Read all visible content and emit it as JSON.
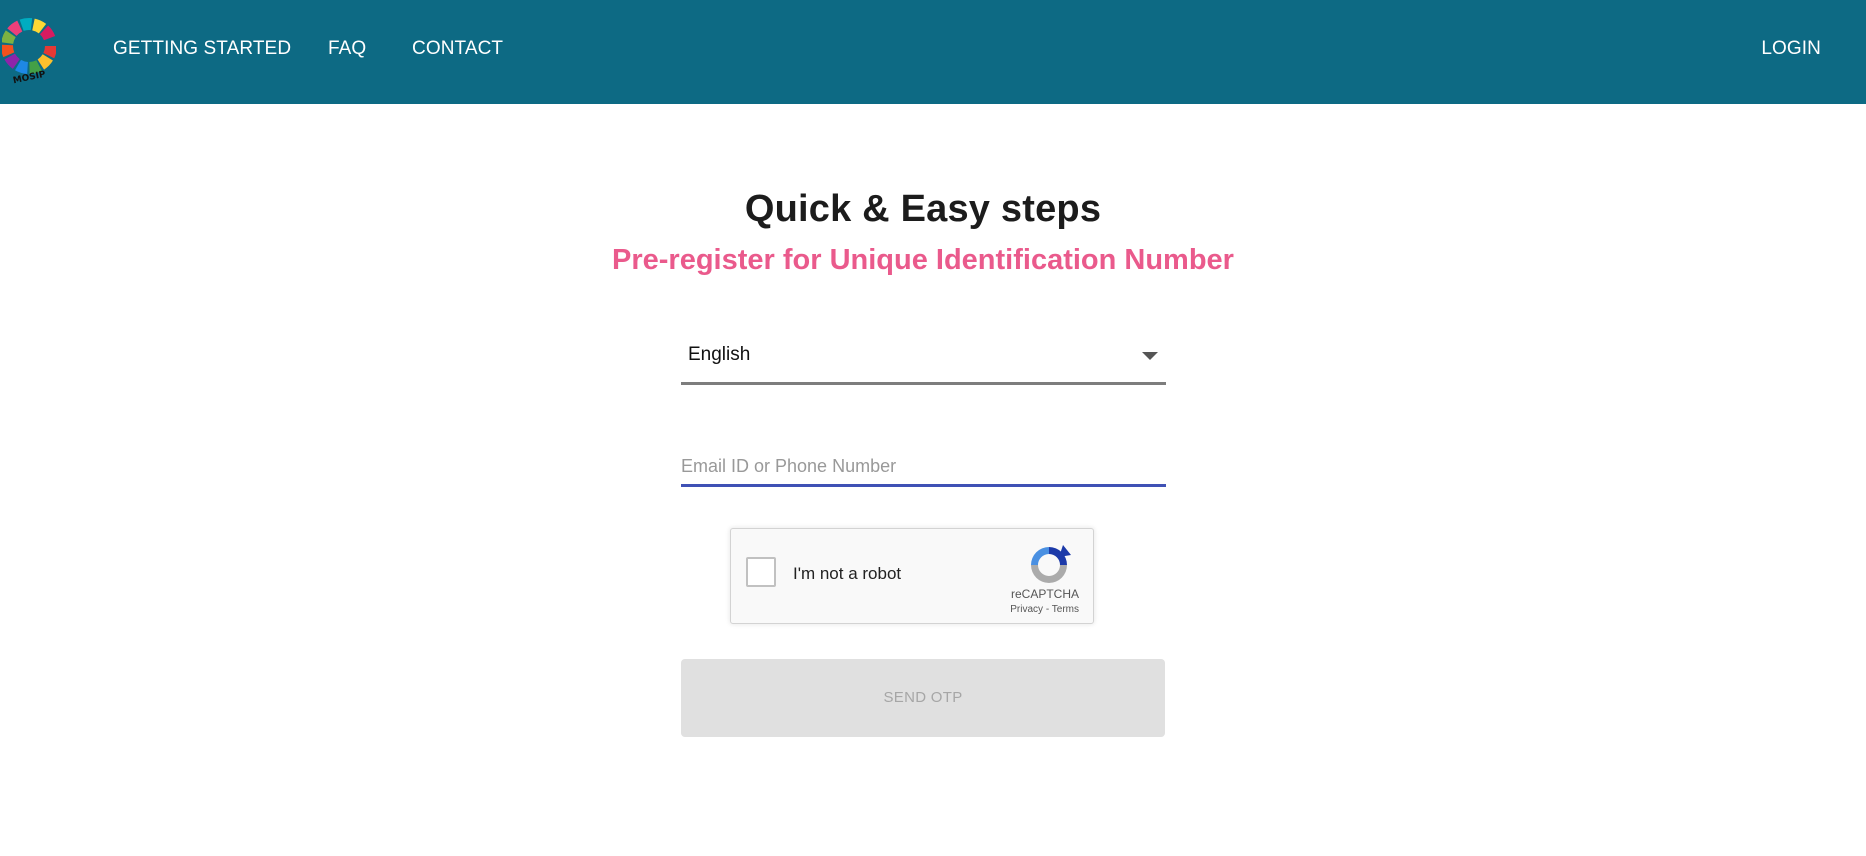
{
  "header": {
    "logo_text": "MOSIP",
    "nav": {
      "getting_started": "GETTING STARTED",
      "faq": "FAQ",
      "contact": "CONTACT",
      "login": "LOGIN"
    }
  },
  "main": {
    "title": "Quick & Easy steps",
    "subtitle": "Pre-register for Unique Identification Number",
    "language_select": {
      "value": "English"
    },
    "email_field": {
      "placeholder": "Email ID or Phone Number",
      "value": ""
    },
    "recaptcha": {
      "label": "I'm not a robot",
      "brand": "reCAPTCHA",
      "privacy": "Privacy",
      "separator": "-",
      "terms": "Terms",
      "checked": false
    },
    "send_otp_label": "SEND OTP"
  },
  "colors": {
    "header_bg": "#0d6a84",
    "subtitle": "#ea5a8c",
    "input_focus": "#3f51b5",
    "button_disabled_bg": "#e0e0e0"
  }
}
